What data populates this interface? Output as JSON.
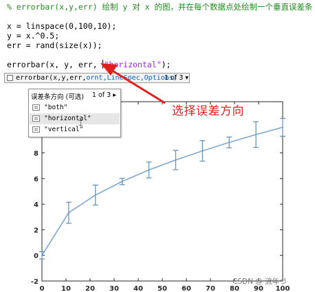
{
  "editor": {
    "comment": "% errorbar(x,y,err) 绘制 y 对 x 的图，并在每个数据点处绘制一个垂直误差条",
    "line_x": "x = linspace(0,100,10);",
    "line_y": "y = x.^0.5;",
    "line_err": "err = rand(size(x));",
    "call_prefix": "errorbar(x, y, err, ",
    "call_string": "\"horizontal\"",
    "call_suffix": ");"
  },
  "hint": {
    "sig_prefix": "errorbar(x,y,err,",
    "sig_current": "ornt",
    "sig_suffix": ",LineSpec,Options)",
    "page": "1 of 3 ▾"
  },
  "dropdown": {
    "header": "误差条方向 (可选)",
    "page": "1 of 3 ▸",
    "items": [
      "\"both\"",
      "\"horizontal\"",
      "\"vertical\""
    ],
    "selected_index": 1
  },
  "annotation": {
    "text": "选择误差方向",
    "color": "#e0201e"
  },
  "watermark": "CSDN @ 流年づ",
  "colors": {
    "series": "#7fa7cf",
    "errorbar": "#5b8db8",
    "comment": "#228b22",
    "string": "#a020f0",
    "hint_param": "#1060c8"
  },
  "chart_data": {
    "type": "line",
    "x": [
      0,
      11.11,
      22.22,
      33.33,
      44.44,
      55.56,
      66.67,
      77.78,
      88.89,
      100
    ],
    "series": [
      {
        "values": [
          0,
          3.33,
          4.71,
          5.77,
          6.67,
          7.45,
          8.16,
          8.82,
          9.43,
          10
        ],
        "errors": [
          0.28,
          0.82,
          0.78,
          0.25,
          0.62,
          0.76,
          0.8,
          0.42,
          1.0,
          0.7
        ]
      }
    ],
    "xlim": [
      0,
      100
    ],
    "ylim": [
      -2,
      12
    ],
    "xticks": [
      "0",
      "10",
      "20",
      "30",
      "40",
      "50",
      "60",
      "70",
      "80",
      "90",
      "100"
    ],
    "yticks": [
      "-2",
      "0",
      "2",
      "4",
      "6",
      "8"
    ],
    "grid": false
  }
}
